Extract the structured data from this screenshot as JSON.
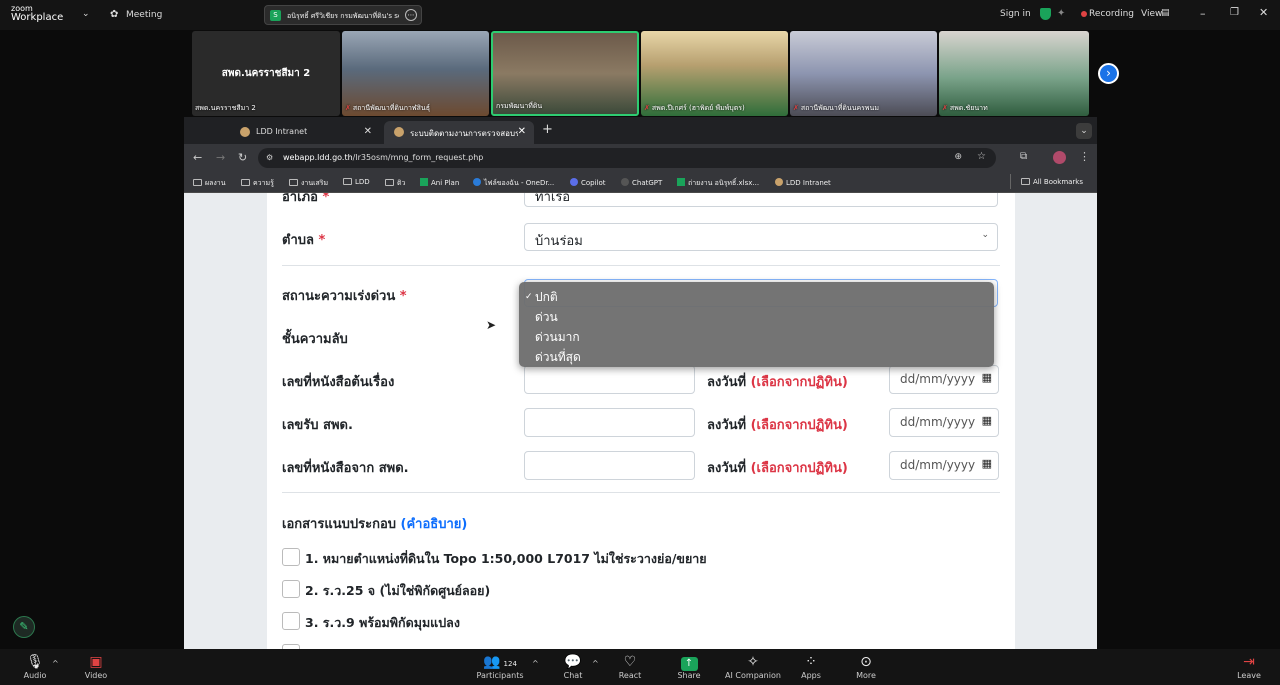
{
  "zoom": {
    "brand_line1": "zoom",
    "brand_line2": "Workplace",
    "meeting_label": "Meeting",
    "share_badge": "S",
    "share_text": "อนิรุทธิ์ ศรีวิเชียร กรมพัฒนาที่ดิน's scr",
    "sign_in": "Sign in",
    "recording": "Recording",
    "view": "View",
    "tiles": [
      {
        "label": "สพด.นครราชสีมา 2",
        "title": "สพด.นครราชสีมา 2"
      },
      {
        "label": "สถานีพัฒนาที่ดินกาฬสินธุ์"
      },
      {
        "label": "กรมพัฒนาที่ดิน"
      },
      {
        "label": "สพด.ปีเกศร์ (ฮาพิดย์ พืมพ์บุตร)"
      },
      {
        "label": "สถานีพัฒนาที่ดินนครพนม"
      },
      {
        "label": "สพด.ชัยนาท"
      }
    ],
    "bottom": {
      "audio": "Audio",
      "video": "Video",
      "participants": "Participants",
      "participants_count": "124",
      "chat": "Chat",
      "react": "React",
      "share": "Share",
      "ai": "AI Companion",
      "apps": "Apps",
      "more": "More",
      "leave": "Leave"
    }
  },
  "browser": {
    "tabs": [
      {
        "title": "LDD Intranet"
      },
      {
        "title": "ระบบติดตามงานการตรวจสอบรา"
      }
    ],
    "url_host": "webapp.ldd.go.th",
    "url_path": "/lr35osm/mng_form_request.php",
    "bookmarks": [
      "ผลงาน",
      "ความรู้",
      "งานเสริม",
      "LDD",
      "ติว",
      "Ani Plan",
      "ไฟล์ของฉัน - OneDr...",
      "Copilot",
      "ChatGPT",
      "ถ่ายงาน อนิรุทธิ์.xlsx...",
      "LDD Intranet"
    ],
    "all_bookmarks": "All Bookmarks"
  },
  "form": {
    "amphoe_label": "อำเภอ",
    "amphoe_value": "ท่าเรือ",
    "tambon_label": "ตำบล",
    "tambon_value": "บ้านร่อม",
    "required_mark": "*",
    "urgency_label": "สถานะความเร่งด่วน",
    "secret_label": "ชั้นความลับ",
    "original_no_label": "เลขที่หนังสือต้นเรื่อง",
    "receive_no_label": "เลขรับ สพด.",
    "from_no_label": "เลขที่หนังสือจาก สพด.",
    "date_label": "ลงวันที่",
    "date_hint": "(เลือกจากปฏิทิน)",
    "date_placeholder": "dd/mm/yyyy",
    "attachments_label": "เอกสารแนบประกอบ",
    "attachments_link": "(คำอธิบาย)",
    "checklist": [
      "1. หมายตำแหน่งที่ดินใน Topo 1:50,000 L7017 ไม่ใช่ระวางย่อ/ขยาย",
      "2. ร.ว.25 จ (ไม่ใช่พิกัดศูนย์ลอย)",
      "3. ร.ว.9 พร้อมพิกัดมุมแปลง"
    ],
    "urgency_options": [
      "ปกติ",
      "ด่วน",
      "ด่วนมาก",
      "ด่วนที่สุด"
    ],
    "urgency_selected": "ปกติ"
  }
}
